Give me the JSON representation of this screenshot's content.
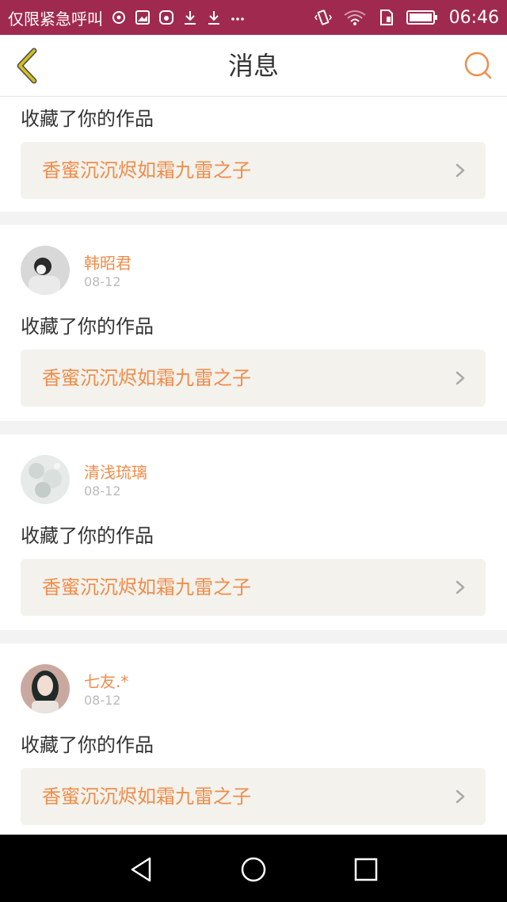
{
  "status_bar": {
    "carrier_text": "仅限紧急呼叫",
    "time": "06:46",
    "left_icons": [
      "location-icon",
      "image-icon",
      "camera-icon",
      "download-icon",
      "download-icon",
      "more-dots-icon"
    ],
    "right_icons": [
      "vibrate-icon",
      "wifi-icon",
      "sim-icon",
      "battery-icon"
    ]
  },
  "header": {
    "title": "消息",
    "back_icon": "back-chevron-icon",
    "search_icon": "search-icon"
  },
  "messages": [
    {
      "user": null,
      "date": null,
      "action": "收藏了你的作品",
      "work_title": "香蜜沉沉烬如霜九雷之子"
    },
    {
      "user": "韩昭君",
      "date": "08-12",
      "action": "收藏了你的作品",
      "work_title": "香蜜沉沉烬如霜九雷之子"
    },
    {
      "user": "清浅琉璃",
      "date": "08-12",
      "action": "收藏了你的作品",
      "work_title": "香蜜沉沉烬如霜九雷之子"
    },
    {
      "user": "七友.*",
      "date": "08-12",
      "action": "收藏了你的作品",
      "work_title": "香蜜沉沉烬如霜九雷之子"
    }
  ],
  "colors": {
    "accent": "#f08c4a",
    "status_bar": "#a02a4f",
    "back_icon": "#c9b200"
  },
  "nav_bar": {
    "buttons": [
      "back-triangle-icon",
      "home-circle-icon",
      "recents-square-icon"
    ]
  }
}
